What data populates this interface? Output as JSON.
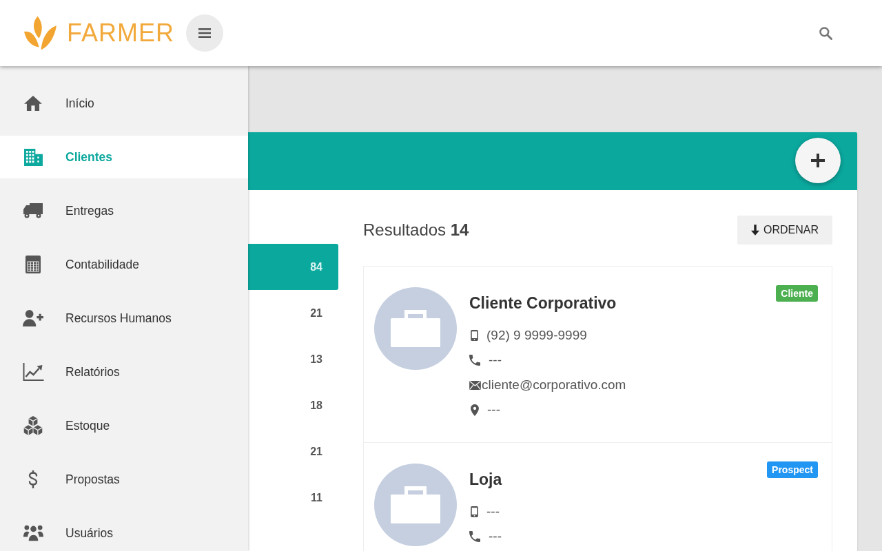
{
  "header": {
    "brand": "FARMER"
  },
  "sidebar": {
    "items": [
      {
        "label": "Início",
        "selected": false
      },
      {
        "label": "Clientes",
        "selected": true
      },
      {
        "label": "Entregas",
        "selected": false
      },
      {
        "label": "Contabilidade",
        "selected": false
      },
      {
        "label": "Recursos Humanos",
        "selected": false
      },
      {
        "label": "Relatórios",
        "selected": false
      },
      {
        "label": "Estoque",
        "selected": false
      },
      {
        "label": "Propostas",
        "selected": false
      },
      {
        "label": "Usuários",
        "selected": false
      }
    ]
  },
  "filters": [
    {
      "count": "84",
      "selected": true
    },
    {
      "count": "21",
      "selected": false
    },
    {
      "count": "13",
      "selected": false
    },
    {
      "count": "18",
      "selected": false
    },
    {
      "count": "21",
      "selected": false
    },
    {
      "count": "11",
      "selected": false
    }
  ],
  "results": {
    "summary": "Resultados **14**",
    "sort_button": "ORDENAR",
    "clients": [
      {
        "name": "Cliente Corporativo",
        "tag": {
          "label": "Cliente",
          "color": "#4caf50"
        },
        "contacts": [
          {
            "kind": "mobile",
            "text": "(92) 9 9999-9999"
          },
          {
            "kind": "phone",
            "text": "---"
          },
          {
            "kind": "email",
            "text": "cliente@corporativo.com"
          },
          {
            "kind": "location",
            "text": "---"
          }
        ]
      },
      {
        "name": "Loja",
        "tag": {
          "label": "Prospect",
          "color": "#2196f3"
        },
        "contacts": [
          {
            "kind": "mobile",
            "text": "---"
          },
          {
            "kind": "phone",
            "text": "---"
          }
        ]
      }
    ]
  }
}
